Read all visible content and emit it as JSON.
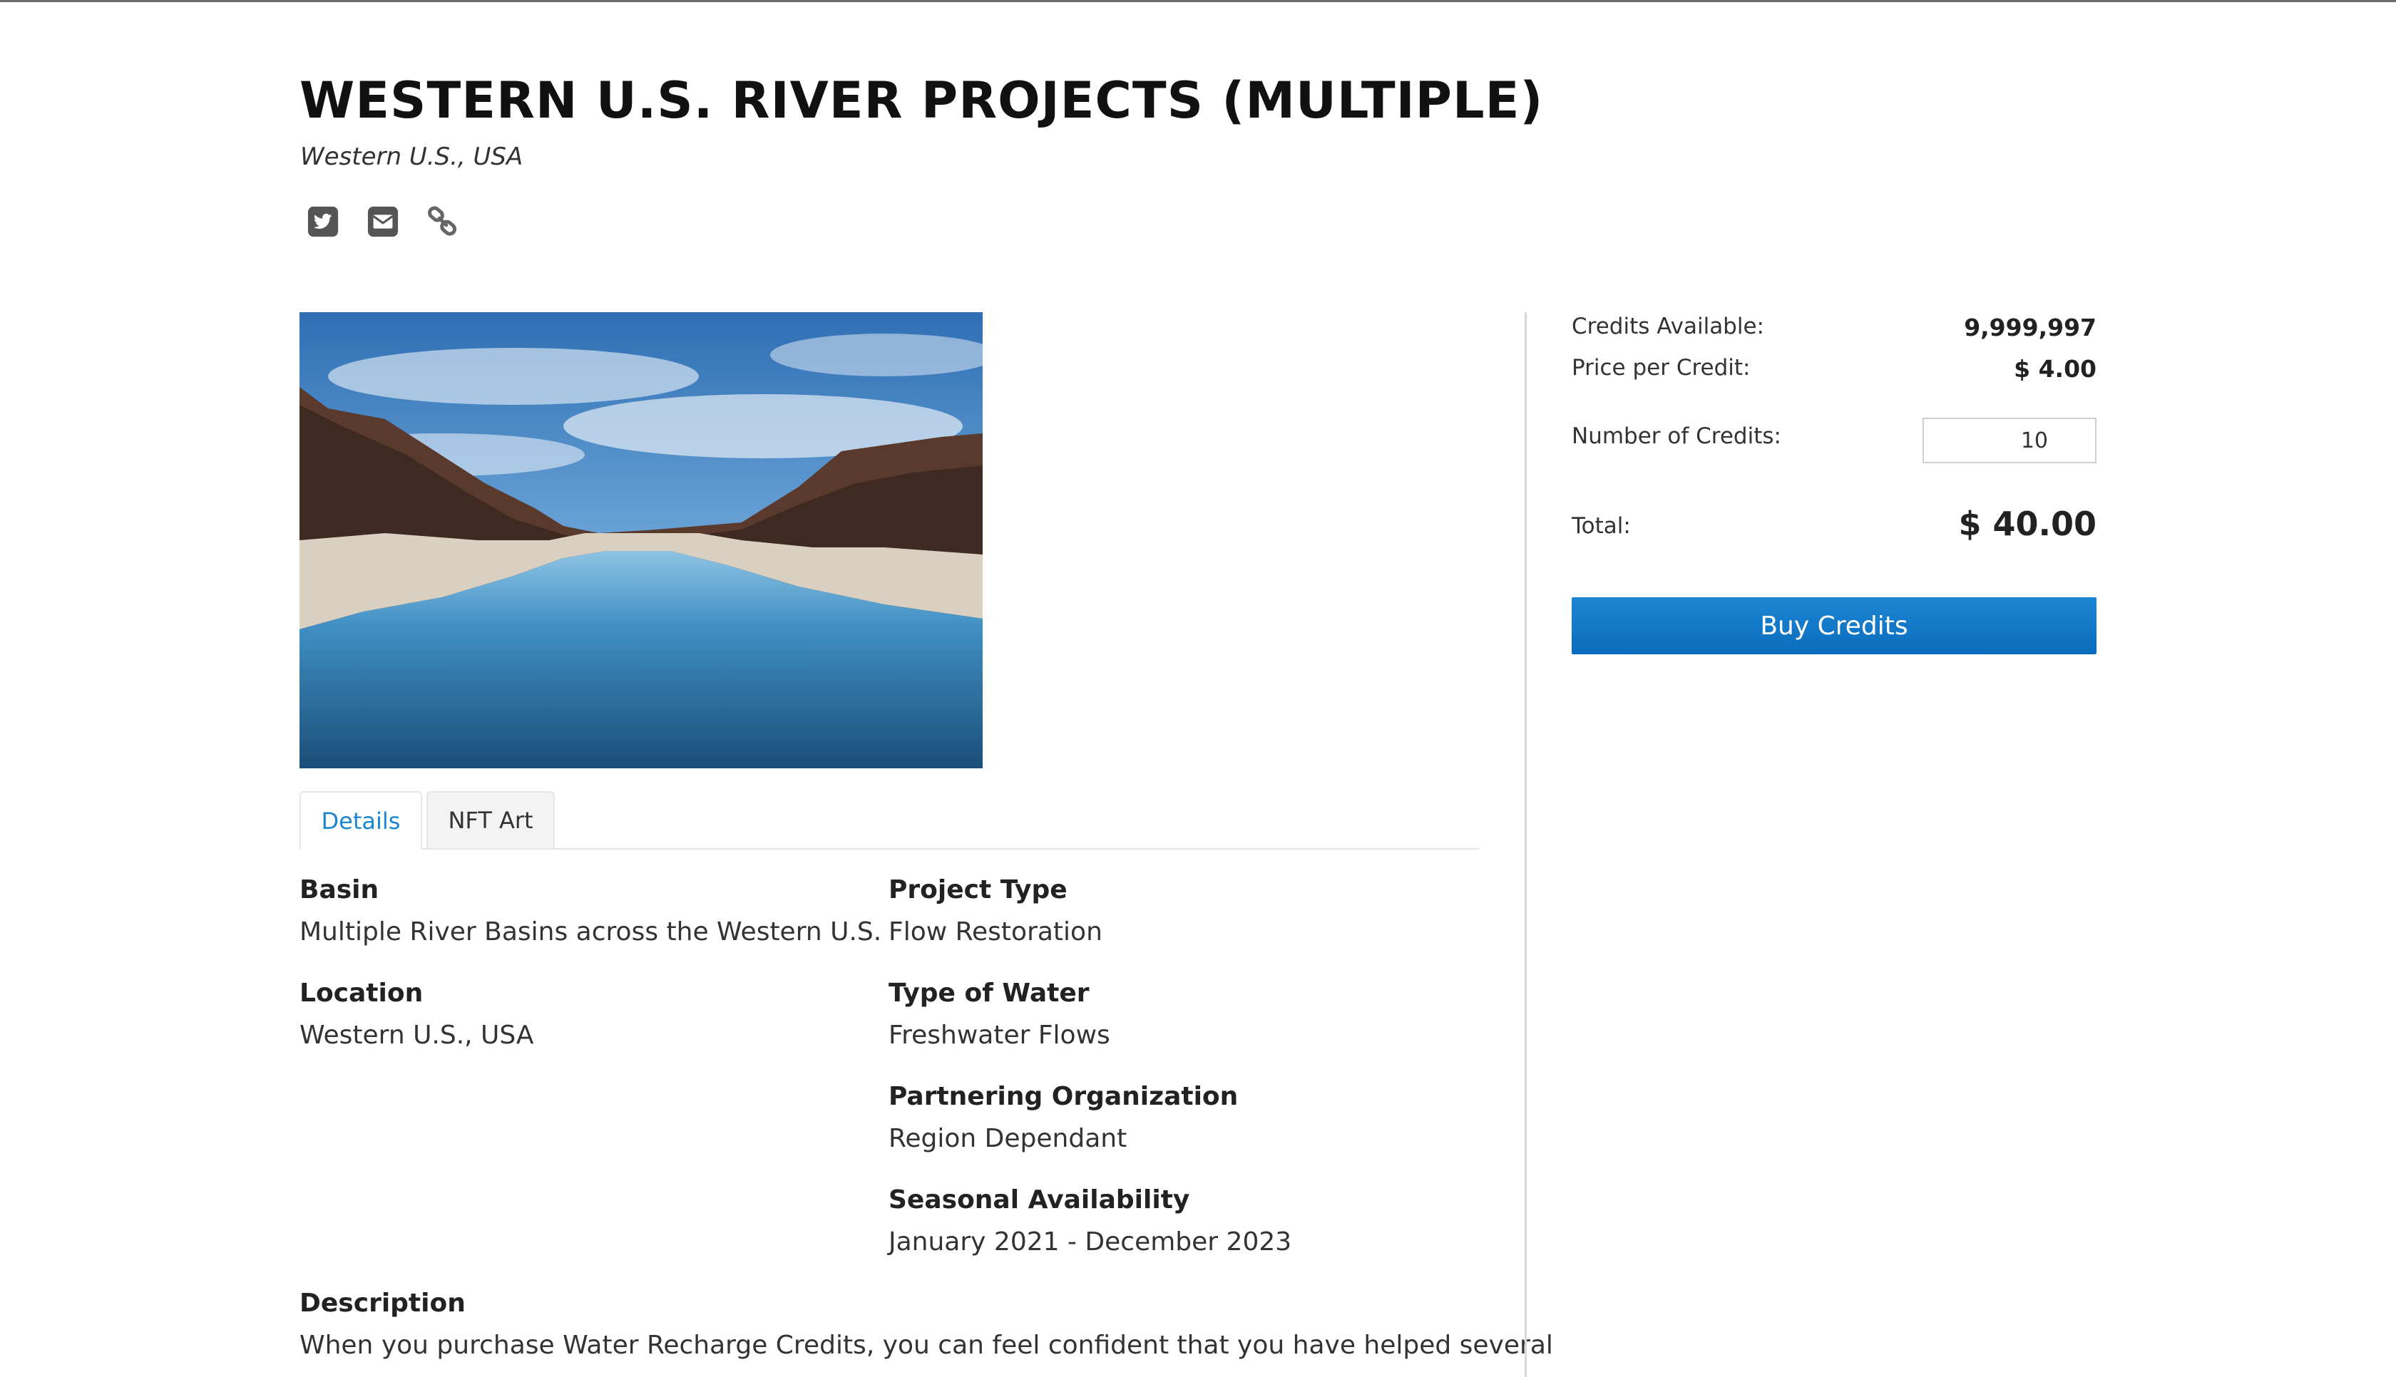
{
  "page": {
    "title": "WESTERN U.S. RIVER PROJECTS (MULTIPLE)",
    "subtitle": "Western U.S., USA"
  },
  "share": [
    {
      "icon": "twitter-icon"
    },
    {
      "icon": "email-icon"
    },
    {
      "icon": "link-icon"
    }
  ],
  "tabs": [
    {
      "label": "Details",
      "active": true
    },
    {
      "label": "NFT Art",
      "active": false
    }
  ],
  "details": {
    "basin": {
      "label": "Basin",
      "value": "Multiple River Basins across the Western U.S."
    },
    "location": {
      "label": "Location",
      "value": "Western U.S., USA"
    },
    "project_type": {
      "label": "Project Type",
      "value": "Flow Restoration"
    },
    "type_of_water": {
      "label": "Type of Water",
      "value": "Freshwater Flows"
    },
    "partnering_org": {
      "label": "Partnering Organization",
      "value": "Region Dependant"
    },
    "seasonal": {
      "label": "Seasonal Availability",
      "value": "January 2021 - December 2023"
    },
    "description": {
      "label": "Description",
      "text": "When you purchase Water Recharge Credits, you can feel confident that you have helped several"
    }
  },
  "purchase": {
    "credits_available_label": "Credits Available:",
    "credits_available_value": "9,999,997",
    "price_label": "Price per Credit:",
    "price_value": "$ 4.00",
    "number_label": "Number of Credits:",
    "number_value": "10",
    "total_label": "Total:",
    "total_value": "$ 40.00",
    "buy_label": "Buy Credits"
  },
  "colors": {
    "accent": "#1a86d1",
    "button": "#0a6cbc"
  }
}
